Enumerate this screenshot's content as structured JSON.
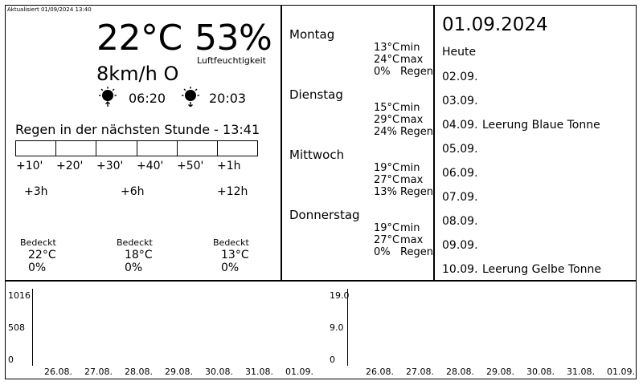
{
  "updated": "Aktualisiert 01/09/2024 13:40",
  "current": {
    "temperature": "22°C",
    "humidity": "53%",
    "humidity_label": "Luftfeuchtigkeit",
    "wind": "8km/h O",
    "sunrise": "06:20",
    "sunset": "20:03"
  },
  "rain": {
    "heading": "Regen in der nächsten Stunde - 13:41",
    "minute_labels": [
      "+10'",
      "+20'",
      "+30'",
      "+40'",
      "+50'",
      "+1h"
    ]
  },
  "hourly": [
    {
      "label": "+3h",
      "condition": "Bedeckt",
      "temp": "22°C",
      "rain": "0%"
    },
    {
      "label": "+6h",
      "condition": "Bedeckt",
      "temp": "18°C",
      "rain": "0%"
    },
    {
      "label": "+12h",
      "condition": "Bedeckt",
      "temp": "13°C",
      "rain": "0%"
    }
  ],
  "forecast": [
    {
      "day": "Montag",
      "min": "13°C",
      "max": "24°C",
      "rain": "0%",
      "min_label": "min",
      "max_label": "max",
      "rain_label": "Regen"
    },
    {
      "day": "Dienstag",
      "min": "15°C",
      "max": "29°C",
      "rain": "24%",
      "min_label": "min",
      "max_label": "max",
      "rain_label": "Regen"
    },
    {
      "day": "Mittwoch",
      "min": "19°C",
      "max": "27°C",
      "rain": "13%",
      "min_label": "min",
      "max_label": "max",
      "rain_label": "Regen"
    },
    {
      "day": "Donnerstag",
      "min": "19°C",
      "max": "27°C",
      "rain": "0%",
      "min_label": "min",
      "max_label": "max",
      "rain_label": "Regen"
    }
  ],
  "calendar": {
    "date": "01.09.2024",
    "today_label": "Heute",
    "days": [
      {
        "date": "02.09.",
        "event": ""
      },
      {
        "date": "03.09.",
        "event": ""
      },
      {
        "date": "04.09.",
        "event": "Leerung Blaue Tonne"
      },
      {
        "date": "05.09.",
        "event": ""
      },
      {
        "date": "06.09.",
        "event": ""
      },
      {
        "date": "07.09.",
        "event": ""
      },
      {
        "date": "08.09.",
        "event": ""
      },
      {
        "date": "09.09.",
        "event": ""
      },
      {
        "date": "10.09.",
        "event": "Leerung Gelbe Tonne"
      }
    ]
  },
  "charts": {
    "left": {
      "y_ticks": [
        "1016",
        "508",
        "0"
      ],
      "x_labels": [
        "26.08.",
        "27.08.",
        "28.08.",
        "29.08.",
        "30.08.",
        "31.08.",
        "01.09."
      ]
    },
    "right": {
      "y_ticks": [
        "19.0",
        "9.0",
        "0"
      ],
      "x_labels": [
        "26.08.",
        "27.08.",
        "28.08.",
        "29.08.",
        "30.08.",
        "31.08.",
        "01.09."
      ]
    }
  }
}
